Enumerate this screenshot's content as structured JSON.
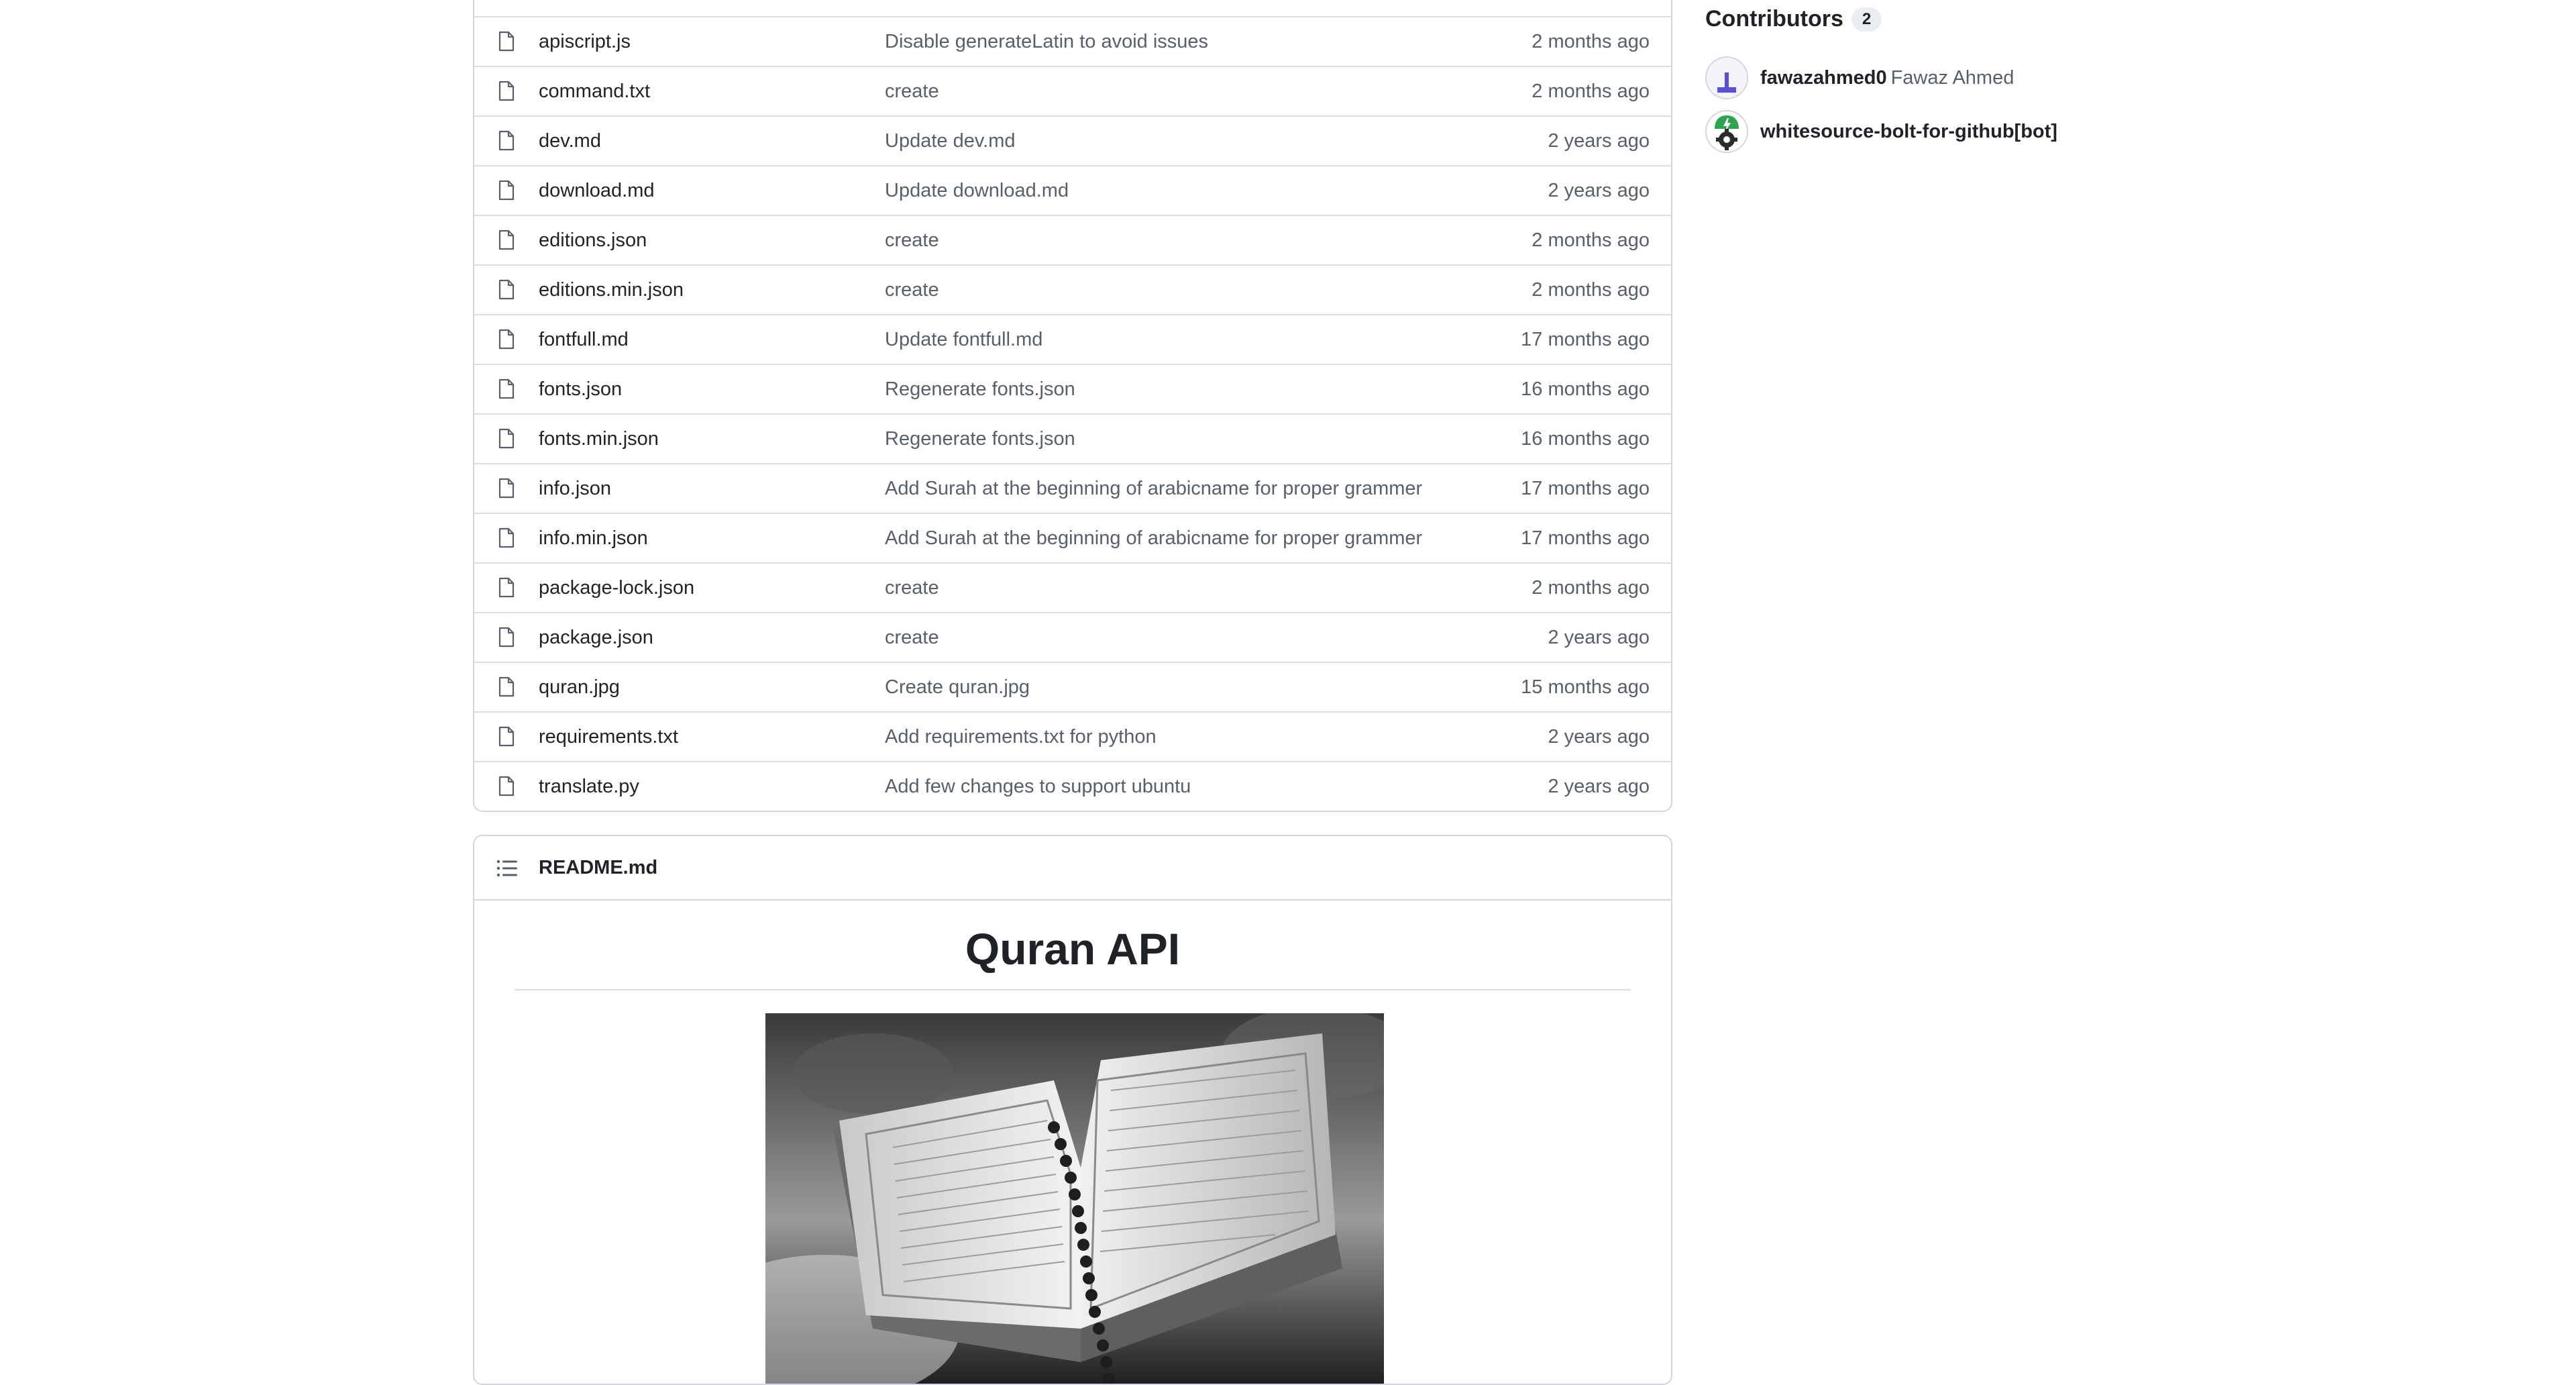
{
  "files": [
    {
      "name": "apiscript.js",
      "message": "Disable generateLatin to avoid issues",
      "date": "2 months ago"
    },
    {
      "name": "command.txt",
      "message": "create",
      "date": "2 months ago"
    },
    {
      "name": "dev.md",
      "message": "Update dev.md",
      "date": "2 years ago"
    },
    {
      "name": "download.md",
      "message": "Update download.md",
      "date": "2 years ago"
    },
    {
      "name": "editions.json",
      "message": "create",
      "date": "2 months ago"
    },
    {
      "name": "editions.min.json",
      "message": "create",
      "date": "2 months ago"
    },
    {
      "name": "fontfull.md",
      "message": "Update fontfull.md",
      "date": "17 months ago"
    },
    {
      "name": "fonts.json",
      "message": "Regenerate fonts.json",
      "date": "16 months ago"
    },
    {
      "name": "fonts.min.json",
      "message": "Regenerate fonts.json",
      "date": "16 months ago"
    },
    {
      "name": "info.json",
      "message": "Add Surah at the beginning of arabicname for proper grammer",
      "date": "17 months ago"
    },
    {
      "name": "info.min.json",
      "message": "Add Surah at the beginning of arabicname for proper grammer",
      "date": "17 months ago"
    },
    {
      "name": "package-lock.json",
      "message": "create",
      "date": "2 months ago"
    },
    {
      "name": "package.json",
      "message": "create",
      "date": "2 years ago"
    },
    {
      "name": "quran.jpg",
      "message": "Create quran.jpg",
      "date": "15 months ago"
    },
    {
      "name": "requirements.txt",
      "message": "Add requirements.txt for python",
      "date": "2 years ago"
    },
    {
      "name": "translate.py",
      "message": "Add few changes to support ubuntu",
      "date": "2 years ago"
    }
  ],
  "readme": {
    "filename": "README.md",
    "heading": "Quran API"
  },
  "contributors": {
    "title": "Contributors",
    "count": "2",
    "list": [
      {
        "login": "fawazahmed0",
        "name": "Fawaz Ahmed"
      },
      {
        "login": "whitesource-bolt-for-github[bot]",
        "name": ""
      }
    ]
  },
  "icons": {
    "file": "file-icon",
    "list": "list-unordered-icon"
  },
  "colors": {
    "text": "#1f2328",
    "muted": "#57606a",
    "border": "#d0d7de",
    "bot_green": "#2ea44f"
  }
}
